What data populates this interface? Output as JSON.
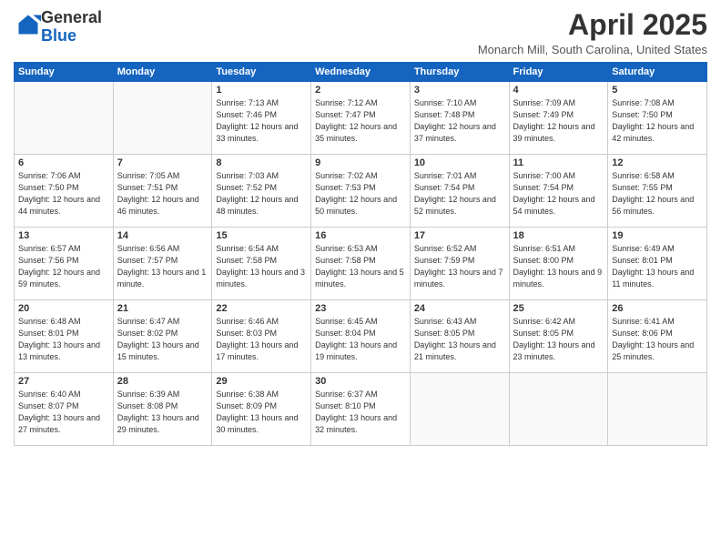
{
  "header": {
    "logo_general": "General",
    "logo_blue": "Blue",
    "month_title": "April 2025",
    "location": "Monarch Mill, South Carolina, United States"
  },
  "weekdays": [
    "Sunday",
    "Monday",
    "Tuesday",
    "Wednesday",
    "Thursday",
    "Friday",
    "Saturday"
  ],
  "weeks": [
    [
      {
        "day": "",
        "empty": true
      },
      {
        "day": "",
        "empty": true
      },
      {
        "day": "1",
        "sunrise": "Sunrise: 7:13 AM",
        "sunset": "Sunset: 7:46 PM",
        "daylight": "Daylight: 12 hours and 33 minutes."
      },
      {
        "day": "2",
        "sunrise": "Sunrise: 7:12 AM",
        "sunset": "Sunset: 7:47 PM",
        "daylight": "Daylight: 12 hours and 35 minutes."
      },
      {
        "day": "3",
        "sunrise": "Sunrise: 7:10 AM",
        "sunset": "Sunset: 7:48 PM",
        "daylight": "Daylight: 12 hours and 37 minutes."
      },
      {
        "day": "4",
        "sunrise": "Sunrise: 7:09 AM",
        "sunset": "Sunset: 7:49 PM",
        "daylight": "Daylight: 12 hours and 39 minutes."
      },
      {
        "day": "5",
        "sunrise": "Sunrise: 7:08 AM",
        "sunset": "Sunset: 7:50 PM",
        "daylight": "Daylight: 12 hours and 42 minutes."
      }
    ],
    [
      {
        "day": "6",
        "sunrise": "Sunrise: 7:06 AM",
        "sunset": "Sunset: 7:50 PM",
        "daylight": "Daylight: 12 hours and 44 minutes."
      },
      {
        "day": "7",
        "sunrise": "Sunrise: 7:05 AM",
        "sunset": "Sunset: 7:51 PM",
        "daylight": "Daylight: 12 hours and 46 minutes."
      },
      {
        "day": "8",
        "sunrise": "Sunrise: 7:03 AM",
        "sunset": "Sunset: 7:52 PM",
        "daylight": "Daylight: 12 hours and 48 minutes."
      },
      {
        "day": "9",
        "sunrise": "Sunrise: 7:02 AM",
        "sunset": "Sunset: 7:53 PM",
        "daylight": "Daylight: 12 hours and 50 minutes."
      },
      {
        "day": "10",
        "sunrise": "Sunrise: 7:01 AM",
        "sunset": "Sunset: 7:54 PM",
        "daylight": "Daylight: 12 hours and 52 minutes."
      },
      {
        "day": "11",
        "sunrise": "Sunrise: 7:00 AM",
        "sunset": "Sunset: 7:54 PM",
        "daylight": "Daylight: 12 hours and 54 minutes."
      },
      {
        "day": "12",
        "sunrise": "Sunrise: 6:58 AM",
        "sunset": "Sunset: 7:55 PM",
        "daylight": "Daylight: 12 hours and 56 minutes."
      }
    ],
    [
      {
        "day": "13",
        "sunrise": "Sunrise: 6:57 AM",
        "sunset": "Sunset: 7:56 PM",
        "daylight": "Daylight: 12 hours and 59 minutes."
      },
      {
        "day": "14",
        "sunrise": "Sunrise: 6:56 AM",
        "sunset": "Sunset: 7:57 PM",
        "daylight": "Daylight: 13 hours and 1 minute."
      },
      {
        "day": "15",
        "sunrise": "Sunrise: 6:54 AM",
        "sunset": "Sunset: 7:58 PM",
        "daylight": "Daylight: 13 hours and 3 minutes."
      },
      {
        "day": "16",
        "sunrise": "Sunrise: 6:53 AM",
        "sunset": "Sunset: 7:58 PM",
        "daylight": "Daylight: 13 hours and 5 minutes."
      },
      {
        "day": "17",
        "sunrise": "Sunrise: 6:52 AM",
        "sunset": "Sunset: 7:59 PM",
        "daylight": "Daylight: 13 hours and 7 minutes."
      },
      {
        "day": "18",
        "sunrise": "Sunrise: 6:51 AM",
        "sunset": "Sunset: 8:00 PM",
        "daylight": "Daylight: 13 hours and 9 minutes."
      },
      {
        "day": "19",
        "sunrise": "Sunrise: 6:49 AM",
        "sunset": "Sunset: 8:01 PM",
        "daylight": "Daylight: 13 hours and 11 minutes."
      }
    ],
    [
      {
        "day": "20",
        "sunrise": "Sunrise: 6:48 AM",
        "sunset": "Sunset: 8:01 PM",
        "daylight": "Daylight: 13 hours and 13 minutes."
      },
      {
        "day": "21",
        "sunrise": "Sunrise: 6:47 AM",
        "sunset": "Sunset: 8:02 PM",
        "daylight": "Daylight: 13 hours and 15 minutes."
      },
      {
        "day": "22",
        "sunrise": "Sunrise: 6:46 AM",
        "sunset": "Sunset: 8:03 PM",
        "daylight": "Daylight: 13 hours and 17 minutes."
      },
      {
        "day": "23",
        "sunrise": "Sunrise: 6:45 AM",
        "sunset": "Sunset: 8:04 PM",
        "daylight": "Daylight: 13 hours and 19 minutes."
      },
      {
        "day": "24",
        "sunrise": "Sunrise: 6:43 AM",
        "sunset": "Sunset: 8:05 PM",
        "daylight": "Daylight: 13 hours and 21 minutes."
      },
      {
        "day": "25",
        "sunrise": "Sunrise: 6:42 AM",
        "sunset": "Sunset: 8:05 PM",
        "daylight": "Daylight: 13 hours and 23 minutes."
      },
      {
        "day": "26",
        "sunrise": "Sunrise: 6:41 AM",
        "sunset": "Sunset: 8:06 PM",
        "daylight": "Daylight: 13 hours and 25 minutes."
      }
    ],
    [
      {
        "day": "27",
        "sunrise": "Sunrise: 6:40 AM",
        "sunset": "Sunset: 8:07 PM",
        "daylight": "Daylight: 13 hours and 27 minutes."
      },
      {
        "day": "28",
        "sunrise": "Sunrise: 6:39 AM",
        "sunset": "Sunset: 8:08 PM",
        "daylight": "Daylight: 13 hours and 29 minutes."
      },
      {
        "day": "29",
        "sunrise": "Sunrise: 6:38 AM",
        "sunset": "Sunset: 8:09 PM",
        "daylight": "Daylight: 13 hours and 30 minutes."
      },
      {
        "day": "30",
        "sunrise": "Sunrise: 6:37 AM",
        "sunset": "Sunset: 8:10 PM",
        "daylight": "Daylight: 13 hours and 32 minutes."
      },
      {
        "day": "",
        "empty": true
      },
      {
        "day": "",
        "empty": true
      },
      {
        "day": "",
        "empty": true
      }
    ]
  ]
}
